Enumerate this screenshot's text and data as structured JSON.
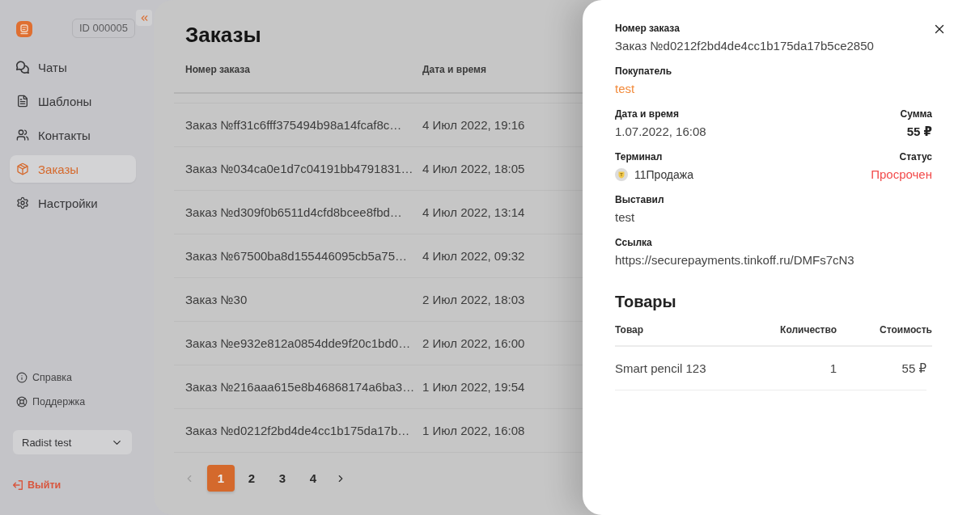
{
  "sidebar": {
    "account_id": "ID 000005",
    "nav": [
      {
        "label": "Чаты",
        "selected": false
      },
      {
        "label": "Шаблоны",
        "selected": false
      },
      {
        "label": "Контакты",
        "selected": false
      },
      {
        "label": "Заказы",
        "selected": true
      },
      {
        "label": "Настройки",
        "selected": false
      }
    ],
    "help_links": [
      "Справка",
      "Поддержка"
    ],
    "workspace_select": {
      "value": "Radist test"
    },
    "logout": "Выйти"
  },
  "orders": {
    "title": "Заказы",
    "table": {
      "columns": [
        "Номер заказа",
        "Дата и время"
      ],
      "rows": [
        {
          "order": "Заказ №ff31c6fff375494b98a14fcaf8c…",
          "date": "4 Июл 2022, 19:16"
        },
        {
          "order": "Заказ №034ca0e1d7c04191bb4791831…",
          "date": "4 Июл 2022, 18:05"
        },
        {
          "order": "Заказ №d309f0b6511d4cfd8bcee8fbd…",
          "date": "4 Июл 2022, 13:14"
        },
        {
          "order": "Заказ №67500ba8d155446095cb5a75…",
          "date": "4 Июл 2022, 09:32"
        },
        {
          "order": "Заказ №30",
          "date": "2 Июл 2022, 18:03"
        },
        {
          "order": "Заказ №e932e812a0854dde9f20c1bd0…",
          "date": "2 Июл 2022, 16:00"
        },
        {
          "order": "Заказ №216aaa615e8b46868174a6ba3…",
          "date": "1 Июл 2022, 19:54"
        },
        {
          "order": "Заказ №d0212f2bd4de4cc1b175da17b…",
          "date": "1 Июл 2022, 16:08"
        }
      ]
    },
    "pagination": {
      "prev": {
        "disabled": true
      },
      "pages": [
        {
          "label": "1",
          "selected": true
        },
        {
          "label": "2",
          "selected": false
        },
        {
          "label": "3",
          "selected": false
        },
        {
          "label": "4",
          "selected": false
        }
      ],
      "next": {
        "disabled": false
      }
    }
  },
  "order_details": {
    "order_number": {
      "label": "Номер заказа",
      "value": "Заказ №d0212f2bd4de4cc1b175da17b5ce2850"
    },
    "buyer": {
      "label": "Покупатель",
      "value": "test"
    },
    "date": {
      "label": "Дата и время",
      "value": "1.07.2022, 16:08"
    },
    "amount": {
      "label": "Сумма",
      "value": "55 ₽"
    },
    "terminal": {
      "label": "Терминал",
      "value": "11Продажа"
    },
    "status": {
      "label": "Статус",
      "value": "Просрочен"
    },
    "issued_by": {
      "label": "Выставил",
      "value": "test"
    },
    "link": {
      "label": "Ссылка",
      "value": "https://securepayments.tinkoff.ru/DMFs7cN3"
    },
    "products": {
      "title": "Товары",
      "columns": [
        "Товар",
        "Количество",
        "Стоимость"
      ],
      "rows": [
        {
          "name": "Smart pencil 123",
          "quantity": "1",
          "price": "55 ₽"
        }
      ]
    }
  }
}
